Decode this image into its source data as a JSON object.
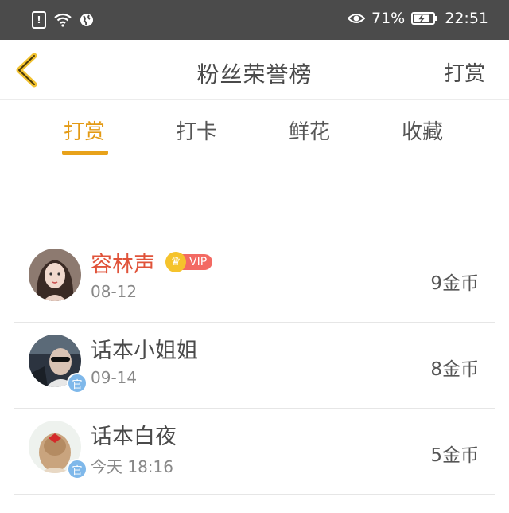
{
  "status_bar": {
    "battery": "71%",
    "time": "22:51"
  },
  "header": {
    "title": "粉丝荣誉榜",
    "action": "打赏"
  },
  "tabs": [
    {
      "label": "打赏"
    },
    {
      "label": "打卡"
    },
    {
      "label": "鲜花"
    },
    {
      "label": "收藏"
    }
  ],
  "list": [
    {
      "name": "容林声",
      "vip": "VIP",
      "date": "08-12",
      "amount": "9金币"
    },
    {
      "name": "话本小姐姐",
      "badge": "官",
      "date": "09-14",
      "amount": "8金币"
    },
    {
      "name": "话本白夜",
      "badge": "官",
      "date": "今天 18:16",
      "amount": "5金币"
    }
  ]
}
